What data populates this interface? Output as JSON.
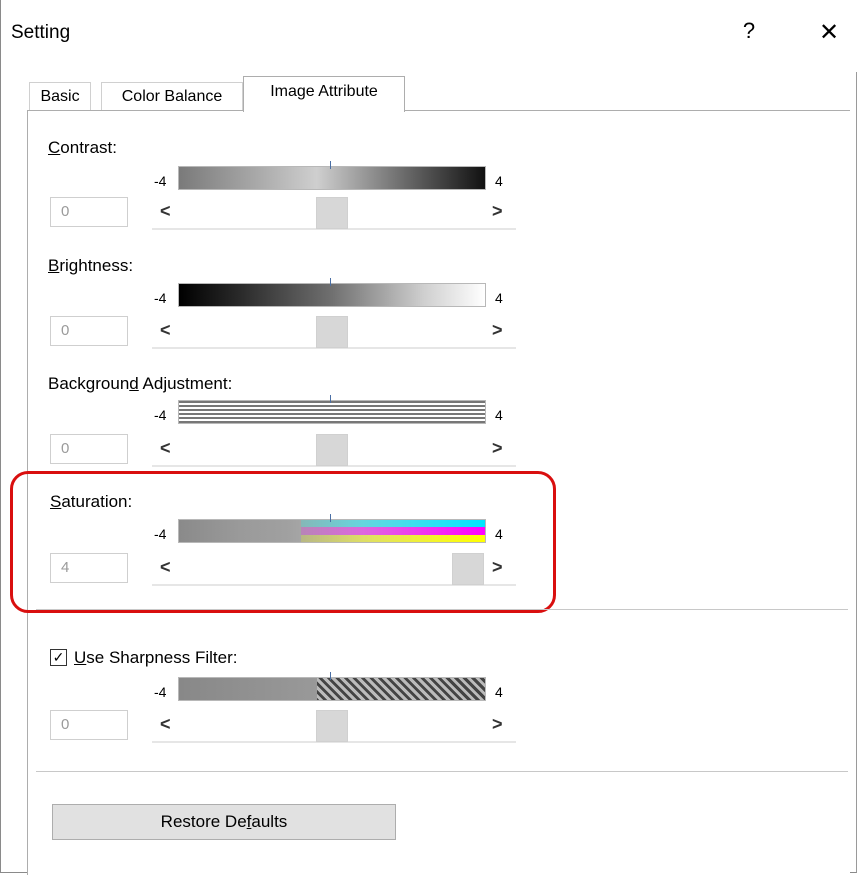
{
  "window": {
    "title": "Setting",
    "help_label": "?",
    "close_label": "✕"
  },
  "tabs": [
    {
      "label": "Basic"
    },
    {
      "label": "Color Balance"
    },
    {
      "label": "Image Attribute"
    }
  ],
  "active_tab": "Image Attribute",
  "controls": {
    "contrast": {
      "label_main": "ontrast:",
      "label_ul": "C",
      "min": "-4",
      "max": "4",
      "value": "0",
      "level": 0
    },
    "brightness": {
      "label_main": "rightness:",
      "label_ul": "B",
      "min": "-4",
      "max": "4",
      "value": "0",
      "level": 0
    },
    "background": {
      "label_pre": "Backgroun",
      "label_ul": "d",
      "label_post": " Adjustment:",
      "min": "-4",
      "max": "4",
      "value": "0",
      "level": 0
    },
    "saturation": {
      "label_main": "aturation:",
      "label_ul": "S",
      "min": "-4",
      "max": "4",
      "value": "4",
      "level": 4
    },
    "sharpness": {
      "label_ul": "U",
      "label_main": "se Sharpness Filter:",
      "checked": true,
      "min": "-4",
      "max": "4",
      "value": "0",
      "level": 0
    }
  },
  "arrows": {
    "left": "<",
    "right": ">"
  },
  "check_mark": "✓",
  "restore_button": {
    "pre": "Restore De",
    "ul": "f",
    "post": "aults"
  },
  "colors": {
    "highlight": "#d90f0f"
  }
}
